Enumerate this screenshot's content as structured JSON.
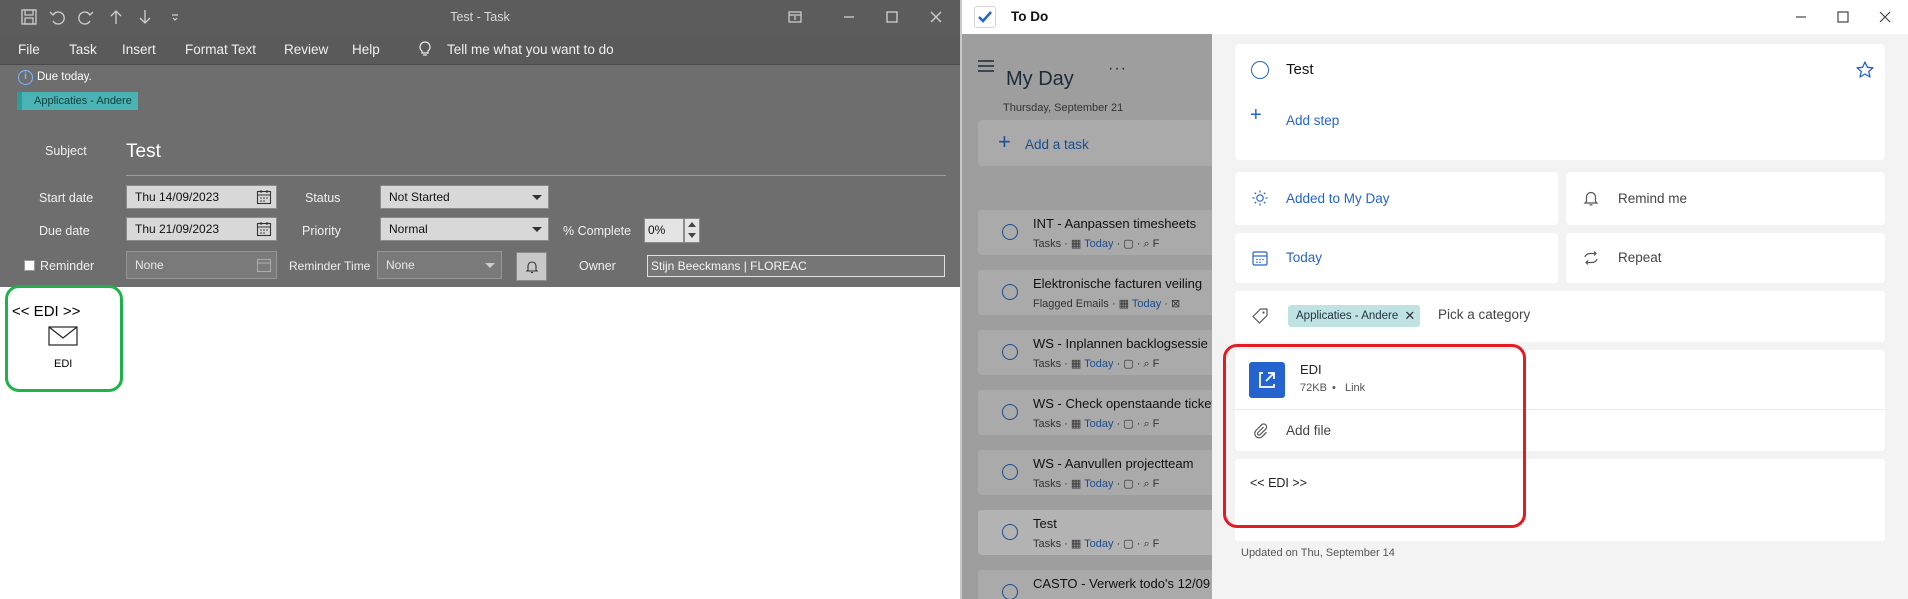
{
  "outlook": {
    "window_title": "Test  -  Task",
    "menu": [
      "File",
      "Task",
      "Insert",
      "Format Text",
      "Review",
      "Help"
    ],
    "tell_me": "Tell me what you want to do",
    "due_notice": "Due today.",
    "category": "Applicaties - Andere",
    "subject_label": "Subject",
    "subject_value": "Test",
    "start_date_label": "Start date",
    "start_date": "Thu 14/09/2023",
    "due_date_label": "Due date",
    "due_date": "Thu 21/09/2023",
    "status_label": "Status",
    "status": "Not Started",
    "priority_label": "Priority",
    "priority": "Normal",
    "complete_label": "% Complete",
    "complete": "0%",
    "reminder_label": "Reminder",
    "reminder_date": "None",
    "reminder_time_label": "Reminder Time",
    "reminder_time": "None",
    "owner_label": "Owner",
    "owner": "Stijn Beeckmans | FLOREAC",
    "body_text": "<< EDI >>",
    "attachment_caption": "EDI"
  },
  "todo": {
    "app_name": "To Do",
    "list_title": "My Day",
    "list_date": "Thursday, September 21",
    "add_task": "Add a task",
    "tasks": [
      {
        "title": "INT - Aanpassen timesheets",
        "list": "Tasks",
        "today": "Today"
      },
      {
        "title": "Elektronische facturen veiling",
        "list": "Flagged Emails",
        "today": "Today"
      },
      {
        "title": "WS - Inplannen backlogsessie",
        "list": "Tasks",
        "today": "Today"
      },
      {
        "title": "WS - Check openstaande tickets",
        "list": "Tasks",
        "today": "Today"
      },
      {
        "title": "WS - Aanvullen projectteam",
        "list": "Tasks",
        "today": "Today"
      },
      {
        "title": "Test",
        "list": "Tasks",
        "today": "Today"
      },
      {
        "title": "CASTO - Verwerk todo's 12/09",
        "list": "",
        "today": ""
      }
    ],
    "detail": {
      "title": "Test",
      "add_step": "Add step",
      "added_to_my_day": "Added to My Day",
      "remind_me": "Remind me",
      "due": "Today",
      "repeat": "Repeat",
      "category": "Applicaties - Andere",
      "pick_category": "Pick a category",
      "file_name": "EDI",
      "file_size": "72KB",
      "file_dot": "•",
      "file_type": "Link",
      "add_file": "Add file",
      "note": "<< EDI >>",
      "updated": "Updated on Thu, September 14"
    }
  },
  "colors": {
    "accent": "#2564cf",
    "category_teal": "#4bb3b3",
    "highlight_green": "#1fb24a",
    "highlight_red": "#e31b23"
  }
}
